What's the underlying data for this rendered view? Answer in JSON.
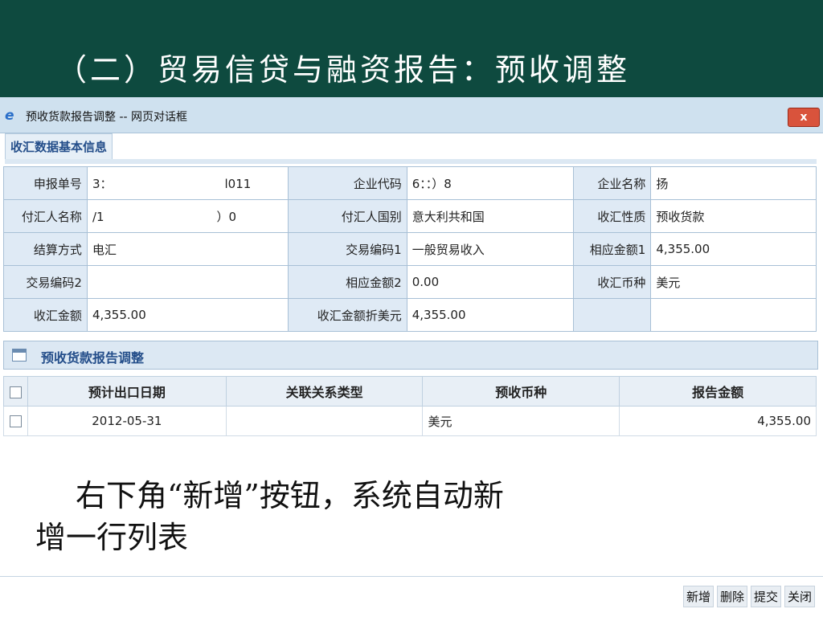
{
  "slide": {
    "title": "（二）贸易信贷与融资报告：预收调整"
  },
  "window": {
    "title": "预收货款报告调整 -- 网页对话框",
    "close_label": "x"
  },
  "section": {
    "title": "收汇数据基本信息"
  },
  "info": {
    "row1": {
      "l1": "申报单号",
      "v1": "3：",
      "v1b": "l011",
      "l2": "企业代码",
      "v2": "6：",
      "v2b": "：）8",
      "l3": "企业名称",
      "v3": "扬"
    },
    "row2": {
      "l1": "付汇人名称",
      "v1": "/1",
      "v1b": "）0",
      "l2": "付汇人国别",
      "v2": "意大利共和国",
      "l3": "收汇性质",
      "v3": "预收货款"
    },
    "row3": {
      "l1": "结算方式",
      "v1": "电汇",
      "l2": "交易编码1",
      "v2": "一般贸易收入",
      "l3": "相应金额1",
      "v3": "4,355.00"
    },
    "row4": {
      "l1": "交易编码2",
      "v1": "",
      "l2": "相应金额2",
      "v2": "0.00",
      "l3": "收汇币种",
      "v3": "美元"
    },
    "row5": {
      "l1": "收汇金额",
      "v1": "4,355.00",
      "l2": "收汇金额折美元",
      "v2": "4,355.00",
      "l3": "",
      "v3": ""
    }
  },
  "subsection": {
    "title": "预收货款报告调整"
  },
  "grid": {
    "headers": {
      "date": "预计出口日期",
      "relation": "关联关系类型",
      "currency": "预收币种",
      "amount": "报告金额"
    },
    "rows": [
      {
        "date": "2012-05-31",
        "relation": "",
        "currency": "美元",
        "amount": "4,355.00"
      }
    ]
  },
  "annotation": {
    "line1": "右下角“新增”按钮，系统自动新",
    "line2": "增一行列表"
  },
  "buttons": {
    "add": "新增",
    "delete": "删除",
    "submit": "提交",
    "close": "关闭"
  }
}
